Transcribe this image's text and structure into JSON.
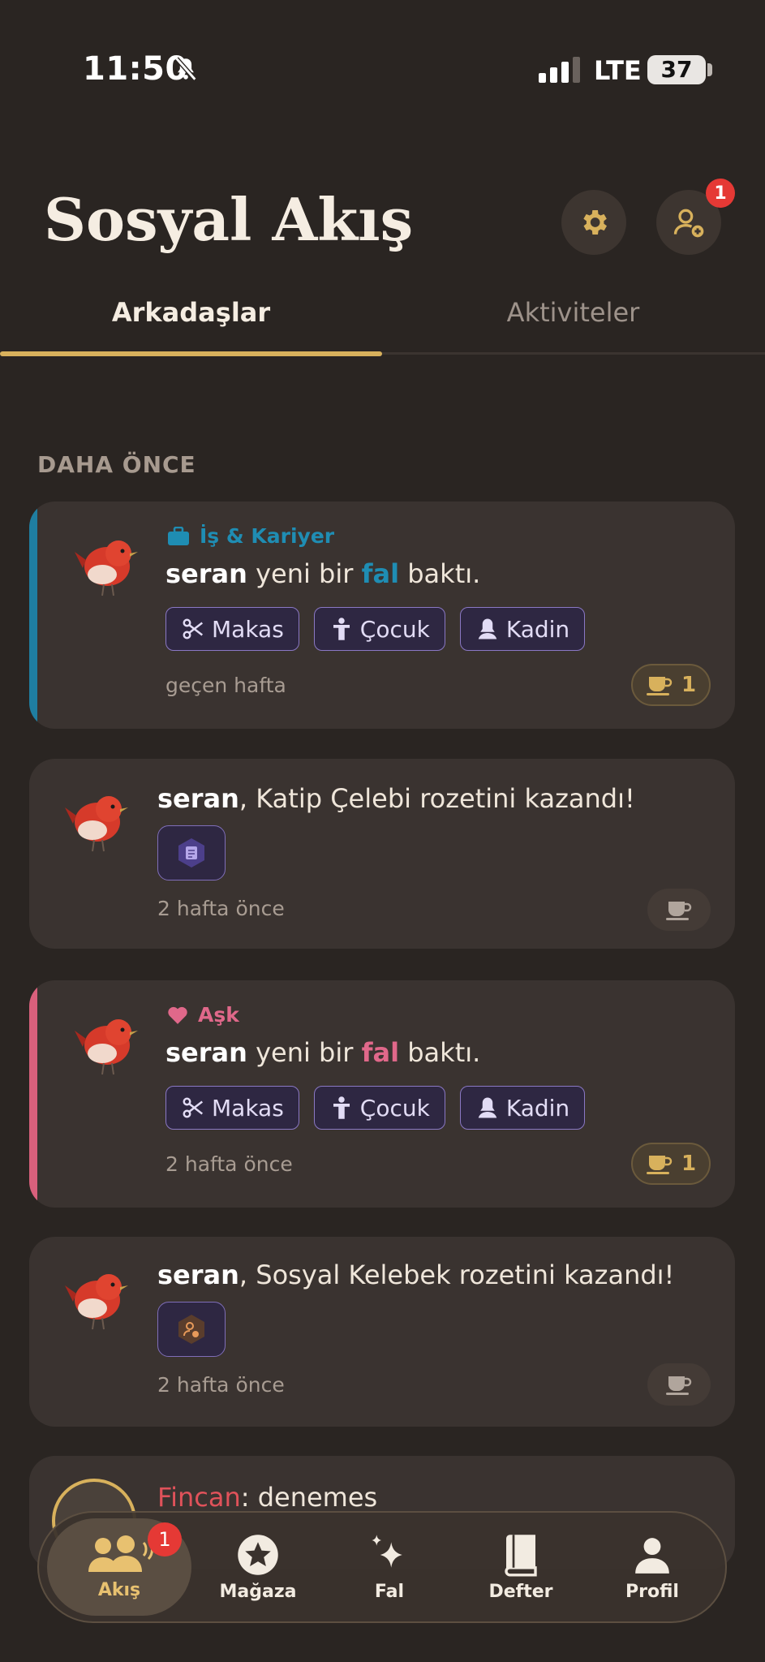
{
  "status_bar": {
    "time": "11:50",
    "network": "LTE",
    "battery": "37"
  },
  "header": {
    "title": "Sosyal Akış",
    "friend_requests_badge": "1"
  },
  "tabs": [
    {
      "label": "Arkadaşlar",
      "active": true
    },
    {
      "label": "Aktiviteler",
      "active": false
    }
  ],
  "section_label": "DAHA ÖNCE",
  "colors": {
    "accent_gold": "#d8b15c",
    "career": "#1f7ea1",
    "love": "#d9607c",
    "badge_red": "#e53935"
  },
  "cards": [
    {
      "category": "İş & Kariyer",
      "user": "seran",
      "pre": " yeni bir ",
      "keyword": "fal",
      "post": " baktı.",
      "chips": [
        "Makas",
        "Çocuk",
        "Kadin"
      ],
      "time": "geçen hafta",
      "cup_count": "1"
    },
    {
      "user": "seran",
      "text": ", Katip Çelebi rozetini kazandı!",
      "badge_icon": "book-icon",
      "time": "2 hafta önce"
    },
    {
      "category": "Aşk",
      "user": "seran",
      "pre": " yeni bir ",
      "keyword": "fal",
      "post": " baktı.",
      "chips": [
        "Makas",
        "Çocuk",
        "Kadin"
      ],
      "time": "2 hafta önce",
      "cup_count": "1"
    },
    {
      "user": "seran",
      "text": ", Sosyal Kelebek rozetini kazandı!",
      "badge_icon": "user-plus-icon",
      "time": "2 hafta önce"
    },
    {
      "user": "Fincan",
      "text": ": denemes"
    }
  ],
  "nav": {
    "items": [
      {
        "label": "Akış",
        "icon": "people-icon",
        "active": true,
        "badge": "1"
      },
      {
        "label": "Mağaza",
        "icon": "star-icon"
      },
      {
        "label": "Fal",
        "icon": "sparkle-icon"
      },
      {
        "label": "Defter",
        "icon": "book-icon"
      },
      {
        "label": "Profil",
        "icon": "person-icon"
      }
    ]
  }
}
